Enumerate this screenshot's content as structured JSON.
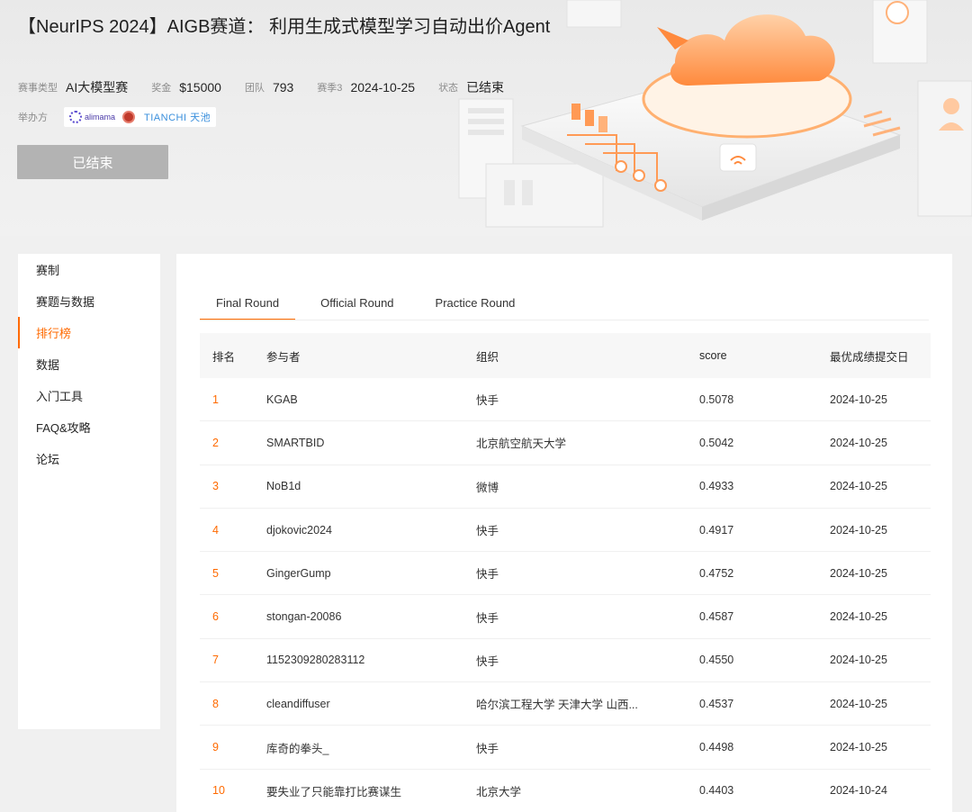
{
  "header": {
    "title": "【NeurIPS 2024】AIGB赛道： 利用生成式模型学习自动出价Agent",
    "meta": [
      {
        "key": "赛事类型",
        "value": "AI大模型赛"
      },
      {
        "key": "奖金",
        "value": "$15000"
      },
      {
        "key": "团队",
        "value": "793"
      },
      {
        "key": "赛季3",
        "value": "2024-10-25"
      },
      {
        "key": "状态",
        "value": "已结束"
      }
    ],
    "organizer_label": "举办方",
    "organizer_logos": [
      "alimama",
      "TIANCHI 天池"
    ],
    "status_button": "已结束"
  },
  "sidebar": {
    "items": [
      "赛制",
      "赛题与数据",
      "排行榜",
      "数据",
      "入门工具",
      "FAQ&攻略",
      "论坛"
    ],
    "active_index": 2
  },
  "tabs": {
    "items": [
      "Final Round",
      "Official Round",
      "Practice Round"
    ],
    "active_index": 0
  },
  "table": {
    "headers": [
      "排名",
      "参与者",
      "组织",
      "score",
      "最优成绩提交日"
    ],
    "rows": [
      [
        "1",
        "KGAB",
        "快手",
        "0.5078",
        "2024-10-25"
      ],
      [
        "2",
        "SMARTBID",
        "北京航空航天大学",
        "0.5042",
        "2024-10-25"
      ],
      [
        "3",
        "NoB1d",
        "微博",
        "0.4933",
        "2024-10-25"
      ],
      [
        "4",
        "djokovic2024",
        "快手",
        "0.4917",
        "2024-10-25"
      ],
      [
        "5",
        "GingerGump",
        "快手",
        "0.4752",
        "2024-10-25"
      ],
      [
        "6",
        "stongan-20086",
        "快手",
        "0.4587",
        "2024-10-25"
      ],
      [
        "7",
        "1152309280283112",
        "快手",
        "0.4550",
        "2024-10-25"
      ],
      [
        "8",
        "cleandiffuser",
        "哈尔滨工程大学 天津大学 山西...",
        "0.4537",
        "2024-10-25"
      ],
      [
        "9",
        "库奇的拳头_",
        "快手",
        "0.4498",
        "2024-10-25"
      ],
      [
        "10",
        "要失业了只能靠打比赛谋生",
        "北京大学",
        "0.4403",
        "2024-10-24"
      ]
    ]
  },
  "colors": {
    "accent": "#ff6a00",
    "disabled_button": "#b3b3b3"
  }
}
